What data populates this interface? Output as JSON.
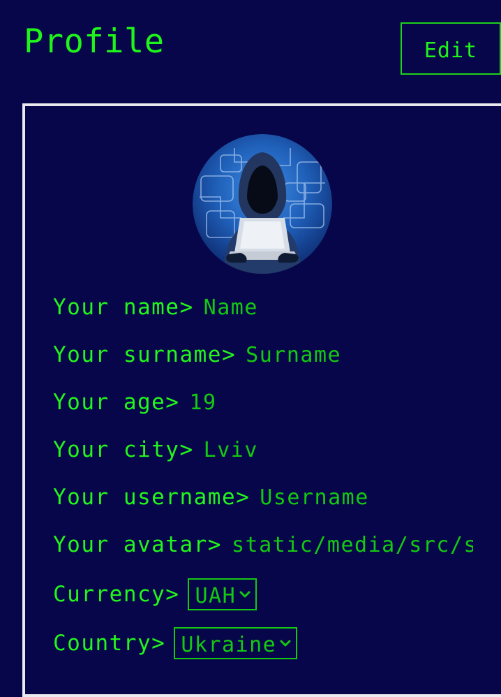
{
  "header": {
    "title": "Profile",
    "edit_label": "Edit"
  },
  "colors": {
    "background": "#07064a",
    "accent": "#1ff51a",
    "value_text": "#14c912",
    "card_border": "#e9e9ef"
  },
  "avatar": {
    "description": "hooded-hacker-icon"
  },
  "fields": [
    {
      "label": "Your name>",
      "value": "Name"
    },
    {
      "label": "Your surname>",
      "value": "Surname"
    },
    {
      "label": "Your age>",
      "value": "19"
    },
    {
      "label": "Your city>",
      "value": "Lviv"
    },
    {
      "label": "Your username>",
      "value": "Username"
    },
    {
      "label": "Your avatar>",
      "value": "static/media/src/s"
    }
  ],
  "currency": {
    "label": "Currency>",
    "selected": "UAH"
  },
  "country": {
    "label": "Country>",
    "selected": "Ukraine"
  }
}
